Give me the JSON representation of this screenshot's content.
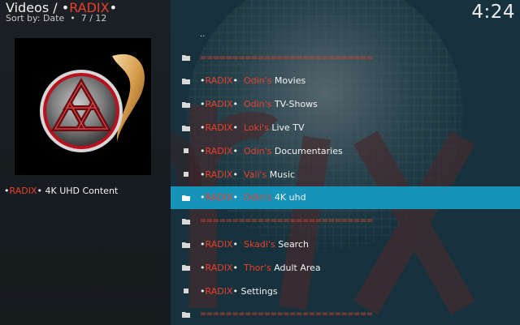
{
  "header": {
    "section": "Videos",
    "separator": "/",
    "addon_dot_left": "•",
    "addon_name": "RADIX",
    "addon_dot_right": "•",
    "sort_label": "Sort by: Date",
    "sort_dot": "•",
    "position": "7 / 12",
    "clock": "4:24"
  },
  "selected": {
    "dot_left": "•",
    "brand": "RADIX",
    "dot_right": "•",
    "title": "4K UHD Content"
  },
  "list": [
    {
      "type": "parent",
      "label": ".."
    },
    {
      "type": "separator",
      "label": "==========================="
    },
    {
      "type": "item",
      "pre": "•",
      "brand": "RADIX",
      "post": "•",
      "god": "Odin's",
      "title": "Movies",
      "icon": "folder-icon"
    },
    {
      "type": "item",
      "pre": "•",
      "brand": "RADIX",
      "post": "•",
      "god": "Odin's",
      "title": "TV-Shows",
      "icon": "folder-icon"
    },
    {
      "type": "item",
      "pre": "•",
      "brand": "RADIX",
      "post": "•",
      "god": "Loki's",
      "title": "Live TV",
      "icon": "folder-icon"
    },
    {
      "type": "item",
      "pre": "•",
      "brand": "RADIX",
      "post": "•",
      "god": "Odin's",
      "title": "Documentaries",
      "icon": "file-icon"
    },
    {
      "type": "item",
      "pre": "•",
      "brand": "RADIX",
      "post": "•",
      "god": "Vali's",
      "title": "Music",
      "icon": "file-icon"
    },
    {
      "type": "item",
      "pre": "•",
      "brand": "RADIX",
      "post": "•",
      "god": "Odin's",
      "title": "4K uhd",
      "icon": "folder-icon",
      "focused": true
    },
    {
      "type": "separator",
      "label": "==========================="
    },
    {
      "type": "item",
      "pre": "•",
      "brand": "RADIX",
      "post": "•",
      "god": "Skadi's",
      "title": "Search",
      "icon": "folder-icon"
    },
    {
      "type": "item",
      "pre": "•",
      "brand": "RADIX",
      "post": "•",
      "god": "Thor's",
      "title": "Adult Area",
      "icon": "folder-icon"
    },
    {
      "type": "item",
      "pre": "•",
      "brand": "RADIX",
      "post": "•",
      "god": "",
      "title": "Settings",
      "icon": "file-icon"
    },
    {
      "type": "separator",
      "label": "==========================="
    }
  ],
  "colors": {
    "accent": "#e8402a",
    "focus": "#1693b9"
  }
}
